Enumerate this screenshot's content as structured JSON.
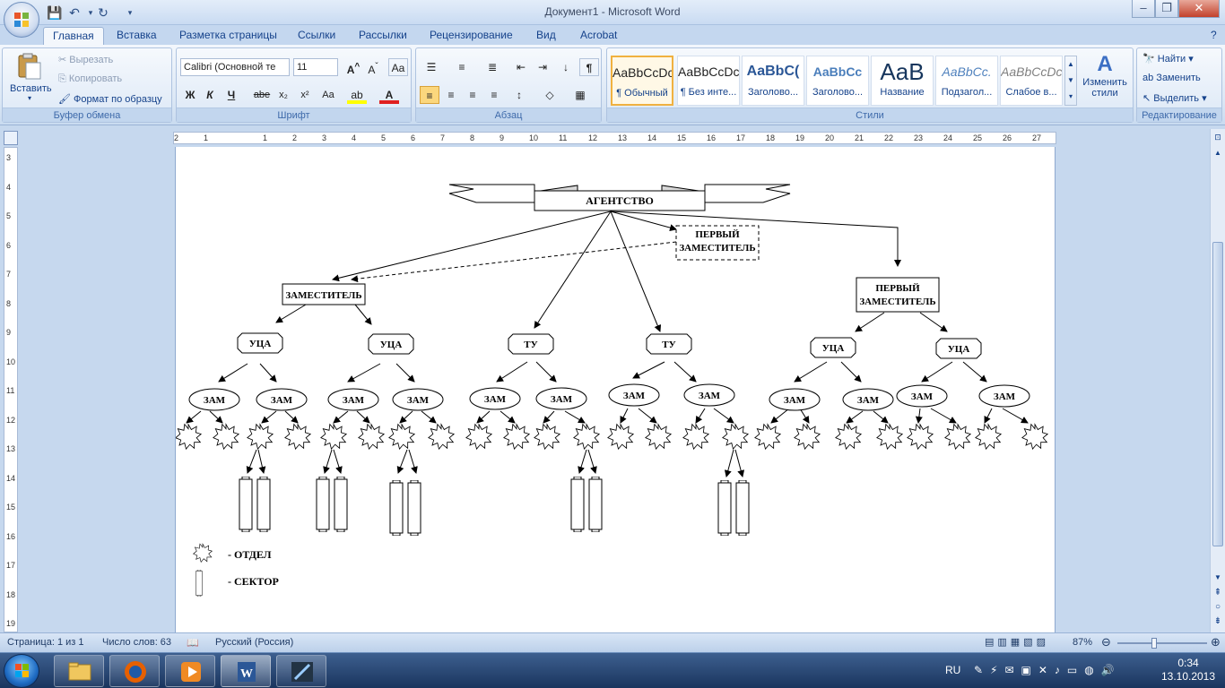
{
  "window": {
    "title": "Документ1 - Microsoft Word"
  },
  "tabs": [
    "Главная",
    "Вставка",
    "Разметка страницы",
    "Ссылки",
    "Рассылки",
    "Рецензирование",
    "Вид",
    "Acrobat"
  ],
  "ribbon": {
    "clipboard": {
      "paste": "Вставить",
      "cut": "Вырезать",
      "copy": "Копировать",
      "format_painter": "Формат по образцу",
      "label": "Буфер обмена"
    },
    "font": {
      "name": "Calibri (Основной те",
      "size": "11",
      "label": "Шрифт",
      "bold": "Ж",
      "italic": "К",
      "underline": "Ч",
      "strike": "abe",
      "subscript": "x₂",
      "superscript": "x²",
      "change_case": "Aa"
    },
    "paragraph": {
      "label": "Абзац",
      "pilcrow": "¶"
    },
    "styles": {
      "label": "Стили",
      "items": [
        {
          "preview": "AaBbCcDc",
          "name": "¶ Обычный"
        },
        {
          "preview": "AaBbCcDc",
          "name": "¶ Без инте..."
        },
        {
          "preview": "AaBbC(",
          "name": "Заголово..."
        },
        {
          "preview": "AaBbCc",
          "name": "Заголово..."
        },
        {
          "preview": "AaB",
          "name": "Название"
        },
        {
          "preview": "AaBbCc.",
          "name": "Подзагол..."
        },
        {
          "preview": "AaBbCcDc",
          "name": "Слабое в..."
        }
      ],
      "change_styles": "Изменить стили"
    },
    "editing": {
      "label": "Редактирование",
      "find": "Найти",
      "replace": "Заменить",
      "select": "Выделить"
    }
  },
  "ruler": {
    "h_ticks": [
      "2",
      "1",
      "",
      "1",
      "2",
      "3",
      "4",
      "5",
      "6",
      "7",
      "8",
      "9",
      "10",
      "11",
      "12",
      "13",
      "14",
      "15",
      "16",
      "17",
      "18",
      "19",
      "20",
      "21",
      "22",
      "23",
      "24",
      "25",
      "26",
      "27"
    ],
    "v_ticks": [
      "3",
      "4",
      "5",
      "6",
      "7",
      "8",
      "9",
      "10",
      "11",
      "12",
      "13",
      "14",
      "15",
      "16",
      "17",
      "18",
      "19"
    ]
  },
  "diagram": {
    "agency": "АГЕНТСТВО",
    "first_deputy_dashed": [
      "ПЕРВЫЙ",
      "ЗАМЕСТИТЕЛЬ"
    ],
    "deputy": "ЗАМЕСТИТЕЛЬ",
    "first_deputy": [
      "ПЕРВЫЙ",
      "ЗАМЕСТИТЕЛЬ"
    ],
    "uca": "УЦА",
    "tu": "ТУ",
    "zam": "ЗАМ",
    "legend_department": "- ОТДЕЛ",
    "legend_sector": "- СЕКТОР"
  },
  "status": {
    "page": "Страница: 1 из 1",
    "words": "Число слов: 63",
    "language": "Русский (Россия)",
    "zoom": "87%"
  },
  "taskbar": {
    "lang": "RU",
    "time": "0:34",
    "date": "13.10.2013"
  }
}
